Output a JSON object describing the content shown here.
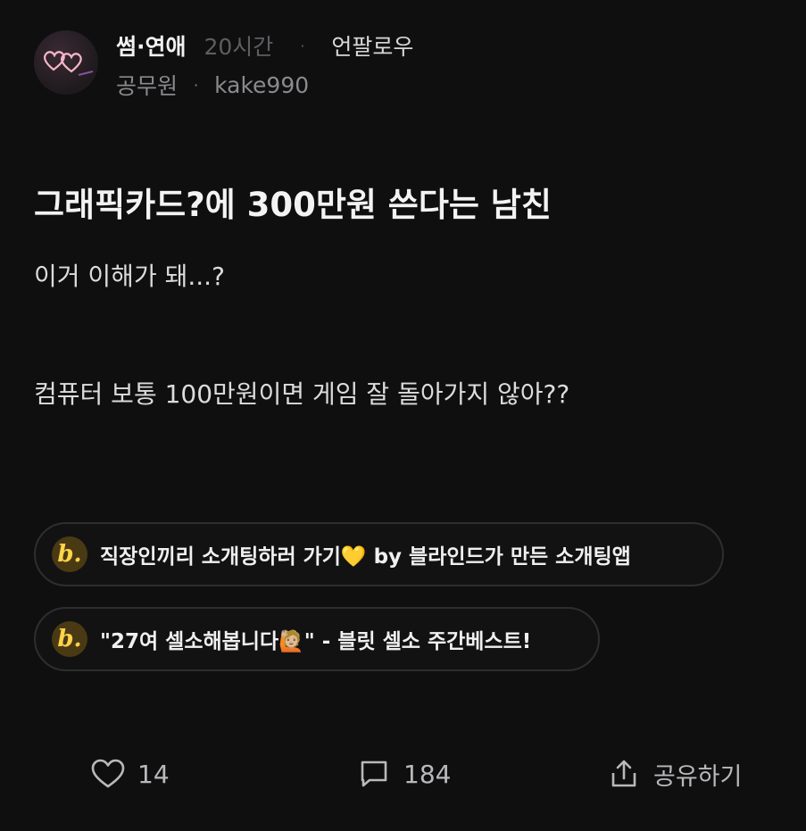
{
  "post": {
    "topic": "썸·연애",
    "time": "20시간",
    "dot": "·",
    "unfollow_label": "언팔로우",
    "job": "공무원",
    "username": "kake990",
    "title": "그래픽카드?에 300만원 쓴다는 남친",
    "body": [
      "이거 이해가 돼...?",
      "컴퓨터 보통 100만원이면 게임 잘 돌아가지 않아??"
    ]
  },
  "ads": [
    {
      "badge": "b.",
      "text": "직장인끼리 소개팅하러 가기💛 by 블라인드가 만든 소개팅앱"
    },
    {
      "badge": "b.",
      "text": "\"27여 셀소해봅니다🙋🏼\" - 블릿 셀소 주간베스트!"
    }
  ],
  "actions": {
    "like_count": "14",
    "comment_count": "184",
    "share_label": "공유하기"
  },
  "icons": {
    "avatar": "heart-outline-pair-icon",
    "like": "heart-icon",
    "comment": "chat-bubble-icon",
    "share": "share-icon"
  },
  "colors": {
    "background": "#0f0f10",
    "text": "#ececec",
    "muted": "#8a8a8e",
    "badge_yellow": "#ffd34a",
    "avatar_heart": "#f7b6c7"
  }
}
